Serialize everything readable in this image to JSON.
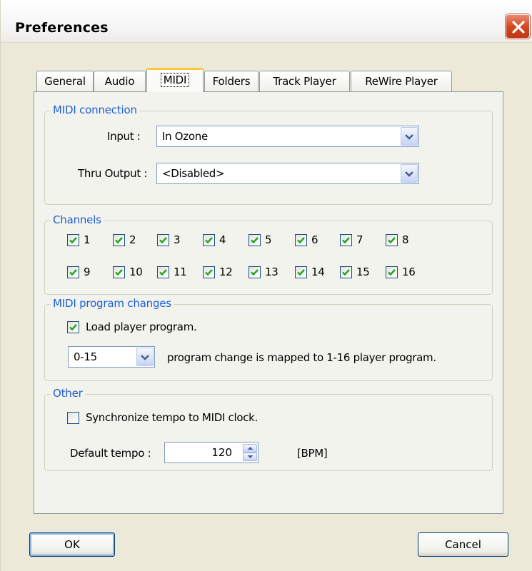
{
  "window": {
    "title": "Preferences"
  },
  "tabs": [
    {
      "label": "General"
    },
    {
      "label": "Audio"
    },
    {
      "label": "MIDI"
    },
    {
      "label": "Folders"
    },
    {
      "label": "Track Player"
    },
    {
      "label": "ReWire Player"
    }
  ],
  "active_tab": "MIDI",
  "midi_connection": {
    "title": "MIDI connection",
    "input_label": "Input :",
    "input_value": "In Ozone",
    "thru_label": "Thru Output :",
    "thru_value": "<Disabled>"
  },
  "channels": {
    "title": "Channels",
    "items": [
      {
        "label": "1",
        "checked": true
      },
      {
        "label": "2",
        "checked": true
      },
      {
        "label": "3",
        "checked": true
      },
      {
        "label": "4",
        "checked": true
      },
      {
        "label": "5",
        "checked": true
      },
      {
        "label": "6",
        "checked": true
      },
      {
        "label": "7",
        "checked": true
      },
      {
        "label": "8",
        "checked": true
      },
      {
        "label": "9",
        "checked": true
      },
      {
        "label": "10",
        "checked": true
      },
      {
        "label": "11",
        "checked": true
      },
      {
        "label": "12",
        "checked": true
      },
      {
        "label": "13",
        "checked": true
      },
      {
        "label": "14",
        "checked": true
      },
      {
        "label": "15",
        "checked": true
      },
      {
        "label": "16",
        "checked": true
      }
    ]
  },
  "program_changes": {
    "title": "MIDI program changes",
    "load_label": "Load player program.",
    "load_checked": true,
    "range_value": "0-15",
    "mapping_text": "program change is mapped to 1-16 player program."
  },
  "other": {
    "title": "Other",
    "sync_label": "Synchronize tempo to MIDI clock.",
    "sync_checked": false,
    "tempo_label": "Default tempo :",
    "tempo_value": "120",
    "tempo_unit": "[BPM]"
  },
  "buttons": {
    "ok": "OK",
    "cancel": "Cancel"
  },
  "colors": {
    "group_title": "#1d5fd6",
    "check_mark": "#21a121",
    "close_button": "#d2451e"
  }
}
